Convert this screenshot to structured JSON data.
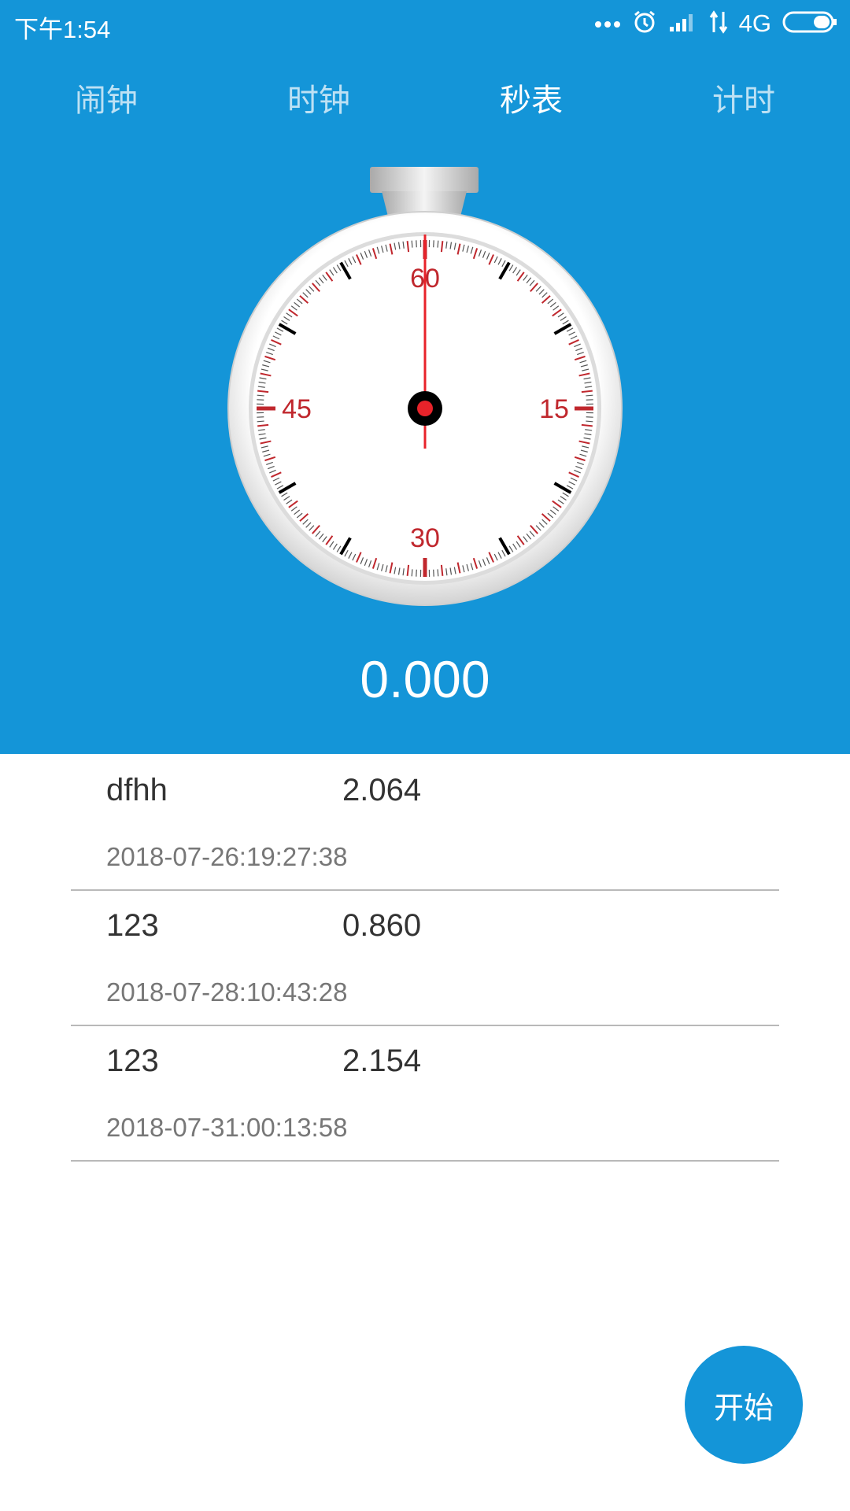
{
  "status_bar": {
    "time": "下午1:54",
    "icons": [
      "more-dots-icon",
      "alarm-icon",
      "signal-icon",
      "data-arrows-icon",
      "battery-icon"
    ],
    "network": "4G"
  },
  "tabs": [
    {
      "label": "闹钟",
      "active": false
    },
    {
      "label": "时钟",
      "active": false
    },
    {
      "label": "秒表",
      "active": true
    },
    {
      "label": "计时",
      "active": false
    }
  ],
  "stopwatch": {
    "dial_labels": {
      "top": "60",
      "right": "15",
      "bottom": "30",
      "left": "45"
    },
    "readout": "0.000"
  },
  "records": [
    {
      "name": "dfhh",
      "value": "2.064",
      "date": "2018-07-26:19:27:38"
    },
    {
      "name": "123",
      "value": "0.860",
      "date": "2018-07-28:10:43:28"
    },
    {
      "name": "123",
      "value": "2.154",
      "date": "2018-07-31:00:13:58"
    }
  ],
  "start_button": {
    "label": "开始"
  },
  "colors": {
    "primary": "#1495d8",
    "dial_red": "#c0272d",
    "hand_red": "#e8232a"
  }
}
